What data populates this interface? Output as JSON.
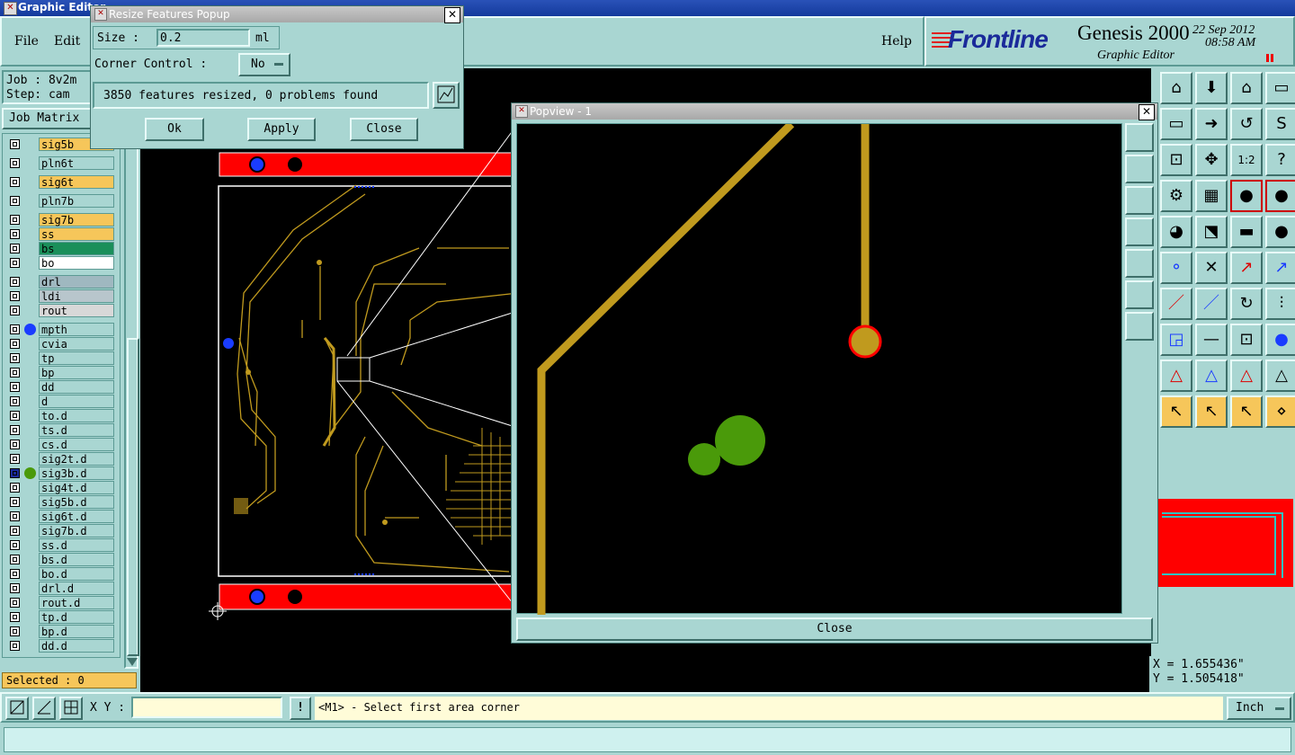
{
  "main_window": {
    "title": "Graphic Editor",
    "menu": {
      "file": "File",
      "edit": "Edit",
      "help": "Help"
    },
    "job_label": "Job : 8v2m",
    "step_label": "Step: cam",
    "job_matrix": "Job Matrix",
    "selected": "Selected : 0",
    "xy_label": "X Y :",
    "xy_value": "",
    "status_message": "<M1> - Select first area corner",
    "units": "Inch",
    "coord_x": "X = 1.655436\"",
    "coord_y": "Y = 1.505418\""
  },
  "brand": {
    "logo": "Frontline",
    "product": "Genesis 2000",
    "subtitle": "Graphic Editor",
    "date": "22 Sep 2012",
    "time": "08:58 AM"
  },
  "layers": [
    {
      "name": "sig5b",
      "color": "#f6c65a"
    },
    {
      "name": "pln6t",
      "color": "#a9d6d2"
    },
    {
      "name": "sig6t",
      "color": "#f6c65a"
    },
    {
      "name": "pln7b",
      "color": "#a9d6d2"
    },
    {
      "name": "sig7b",
      "color": "#f6c65a"
    },
    {
      "name": "ss",
      "color": "#f6c65a"
    },
    {
      "name": "bs",
      "color": "#1a8f5a"
    },
    {
      "name": "bo",
      "color": "#ffffff"
    },
    {
      "name": "drl",
      "color": "#9fb8c0"
    },
    {
      "name": "ldi",
      "color": "#b8c6cc"
    },
    {
      "name": "rout",
      "color": "#d8d8d8"
    },
    {
      "name": "mpth",
      "color": "#a9d6d2"
    },
    {
      "name": "cvia",
      "color": "#a9d6d2"
    },
    {
      "name": "tp",
      "color": "#a9d6d2"
    },
    {
      "name": "bp",
      "color": "#a9d6d2"
    },
    {
      "name": "dd",
      "color": "#a9d6d2"
    },
    {
      "name": "d",
      "color": "#a9d6d2"
    },
    {
      "name": "to.d",
      "color": "#a9d6d2"
    },
    {
      "name": "ts.d",
      "color": "#a9d6d2"
    },
    {
      "name": "cs.d",
      "color": "#a9d6d2"
    },
    {
      "name": "sig2t.d",
      "color": "#a9d6d2"
    },
    {
      "name": "sig3b.d",
      "color": "#a9d6d2"
    },
    {
      "name": "sig4t.d",
      "color": "#a9d6d2"
    },
    {
      "name": "sig5b.d",
      "color": "#a9d6d2"
    },
    {
      "name": "sig6t.d",
      "color": "#a9d6d2"
    },
    {
      "name": "sig7b.d",
      "color": "#a9d6d2"
    },
    {
      "name": "ss.d",
      "color": "#a9d6d2"
    },
    {
      "name": "bs.d",
      "color": "#a9d6d2"
    },
    {
      "name": "bo.d",
      "color": "#a9d6d2"
    },
    {
      "name": "drl.d",
      "color": "#a9d6d2"
    },
    {
      "name": "rout.d",
      "color": "#a9d6d2"
    },
    {
      "name": "tp.d",
      "color": "#a9d6d2"
    },
    {
      "name": "bp.d",
      "color": "#a9d6d2"
    },
    {
      "name": "dd.d",
      "color": "#a9d6d2"
    }
  ],
  "resize_popup": {
    "title": "Resize Features Popup",
    "size_label": "Size :",
    "size_value": "0.2",
    "size_unit": "ml",
    "corner_label": "Corner Control :",
    "corner_value": "No",
    "result": "3850 features resized, 0 problems found",
    "ok": "Ok",
    "apply": "Apply",
    "close": "Close"
  },
  "popview": {
    "title": "Popview - 1",
    "close": "Close"
  },
  "colors": {
    "teal": "#a9d6d2",
    "trace": "#c09a1e",
    "pad_green": "#4a9a0a",
    "pad_ring": "#ff0000",
    "board_red": "#ff0000",
    "via_blue": "#1a3cff"
  }
}
